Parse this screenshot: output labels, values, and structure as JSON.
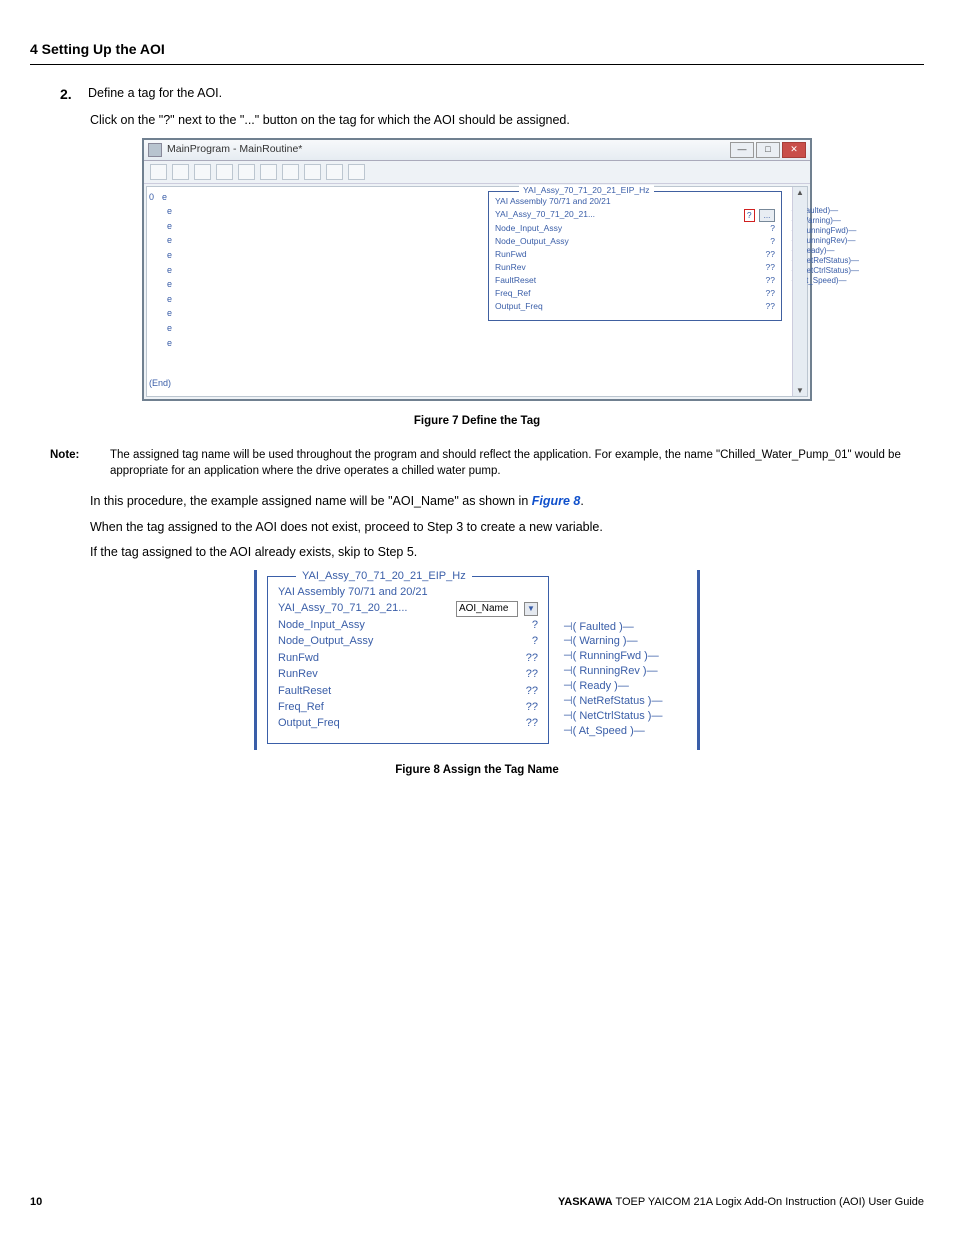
{
  "header": {
    "section": "4 Setting Up the AOI"
  },
  "step": {
    "num": "2.",
    "title": "Define a tag for the AOI.",
    "instr": "Click on the \"?\" next to the \"...\" button on the tag for which the AOI should be assigned."
  },
  "fig7": {
    "caption": "Figure 7  Define the Tag",
    "window_title": "MainProgram - MainRoutine*",
    "rung0": "0",
    "rungE": "e",
    "end": "(End)",
    "block_title": "YAI_Assy_70_71_20_21_EIP_Hz",
    "subtitle": "YAI Assembly 70/71 and 20/21",
    "rows": [
      {
        "l": "YAI_Assy_70_71_20_21...",
        "r_q": "?",
        "r_box": "..."
      },
      {
        "l": "Node_Input_Assy",
        "r": "?"
      },
      {
        "l": "Node_Output_Assy",
        "r": "?"
      },
      {
        "l": "RunFwd",
        "r": "??"
      },
      {
        "l": "RunRev",
        "r": "??"
      },
      {
        "l": "FaultReset",
        "r": "??"
      },
      {
        "l": "Freq_Ref",
        "r": "??"
      },
      {
        "l": "Output_Freq",
        "r": "??"
      }
    ],
    "outs": [
      "Faulted",
      "Warning",
      "RunningFwd",
      "RunningRev",
      "Ready",
      "NetRefStatus",
      "NetCtrlStatus",
      "At_Speed"
    ]
  },
  "note": {
    "label": "Note:",
    "text": "The assigned tag name will be used throughout the program and should reflect the application. For example, the name \"Chilled_Water_Pump_01\" would be appropriate for an application where the drive operates a chilled water pump."
  },
  "para1_a": "In this procedure, the example assigned name will be \"AOI_Name\" as shown in ",
  "para1_link": "Figure 8",
  "para1_b": ".",
  "para2": "When the tag assigned to the AOI does not exist, proceed to Step 3 to create a new variable.",
  "para3": "If the tag assigned to the AOI already exists, skip to Step 5.",
  "fig8": {
    "caption": "Figure 8  Assign the Tag Name",
    "block_title": "YAI_Assy_70_71_20_21_EIP_Hz",
    "subtitle": "YAI Assembly 70/71 and 20/21",
    "rows": [
      {
        "l": "YAI_Assy_70_71_20_21...",
        "input": "AOI_Name"
      },
      {
        "l": "Node_Input_Assy",
        "r": "?"
      },
      {
        "l": "Node_Output_Assy",
        "r": "?"
      },
      {
        "l": "RunFwd",
        "r": "??"
      },
      {
        "l": "RunRev",
        "r": "??"
      },
      {
        "l": "FaultReset",
        "r": "??"
      },
      {
        "l": "Freq_Ref",
        "r": "??"
      },
      {
        "l": "Output_Freq",
        "r": "??"
      }
    ],
    "outs": [
      "Faulted",
      "Warning",
      "RunningFwd",
      "RunningRev",
      "Ready",
      "NetRefStatus",
      "NetCtrlStatus",
      "At_Speed"
    ]
  },
  "footer": {
    "page": "10",
    "brand": "YASKAWA",
    "doc": " TOEP YAICOM 21A Logix Add-On Instruction (AOI) User Guide"
  }
}
